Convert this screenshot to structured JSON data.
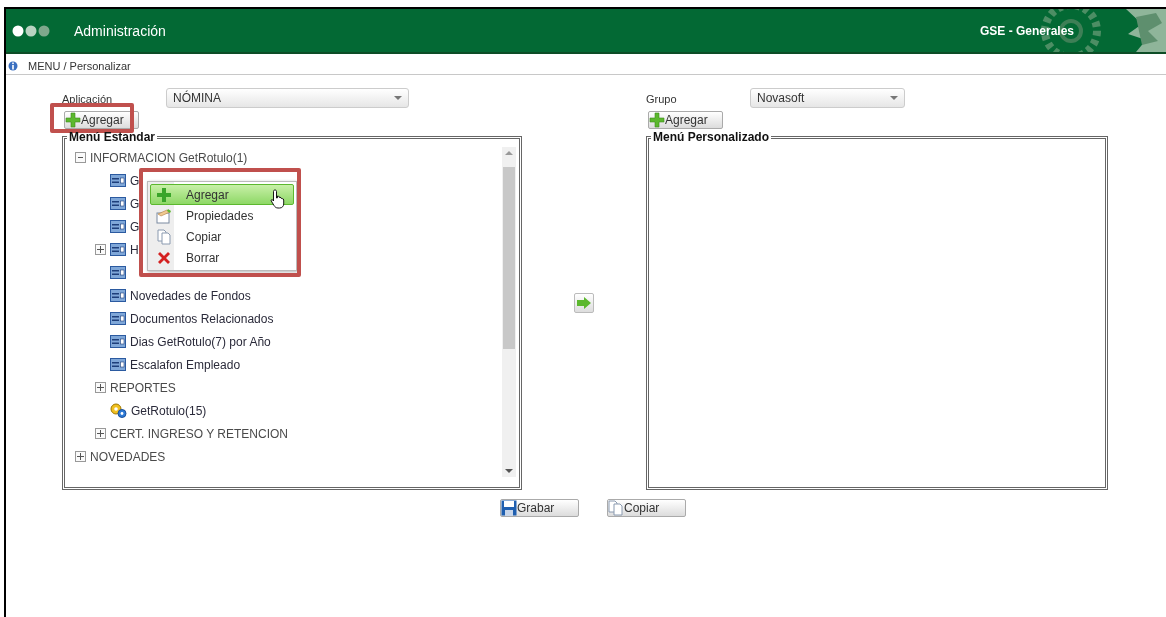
{
  "header": {
    "title": "Administración",
    "module": "GSE - Generales"
  },
  "breadcrumb": "MENU / Personalizar",
  "left": {
    "label": "Aplicación",
    "select_value": "NÓMINA",
    "add_button": "Agregar",
    "legend": "Menú Estandar",
    "tree": [
      {
        "label": "INFORMACION GetRotulo(1)",
        "kind": "folder",
        "expanded": true,
        "children": [
          {
            "label": "G",
            "kind": "form"
          },
          {
            "label": "G",
            "kind": "form"
          },
          {
            "label": "G",
            "kind": "form"
          },
          {
            "label": "H",
            "kind": "form",
            "expanded": false
          },
          {
            "kind": "form"
          },
          {
            "label": "Novedades de Fondos",
            "kind": "form"
          },
          {
            "label": "Documentos Relacionados",
            "kind": "form"
          },
          {
            "label": "Dias GetRotulo(7) por Año",
            "kind": "form"
          },
          {
            "label": "Escalafon Empleado",
            "kind": "form"
          },
          {
            "label": "REPORTES",
            "kind": "folder",
            "expanded": false
          },
          {
            "label": "GetRotulo(15)",
            "kind": "process"
          },
          {
            "label": "CERT. INGRESO Y RETENCION",
            "kind": "folder",
            "expanded": false
          }
        ]
      },
      {
        "label": "NOVEDADES",
        "kind": "folder",
        "expanded": false
      }
    ]
  },
  "context_menu": [
    {
      "label": "Agregar",
      "kind": "add",
      "selected": true
    },
    {
      "label": "Propiedades",
      "kind": "properties",
      "selected": false
    },
    {
      "label": "Copiar",
      "kind": "copy",
      "selected": false
    },
    {
      "label": "Borrar",
      "kind": "delete",
      "selected": false
    }
  ],
  "right": {
    "label": "Grupo",
    "select_value": "Novasoft",
    "add_button": "Agregar",
    "legend": "Menú Personalizado"
  },
  "bottom_buttons": [
    {
      "label": "Grabar",
      "kind": "save"
    },
    {
      "label": "Copiar",
      "kind": "copy"
    }
  ]
}
